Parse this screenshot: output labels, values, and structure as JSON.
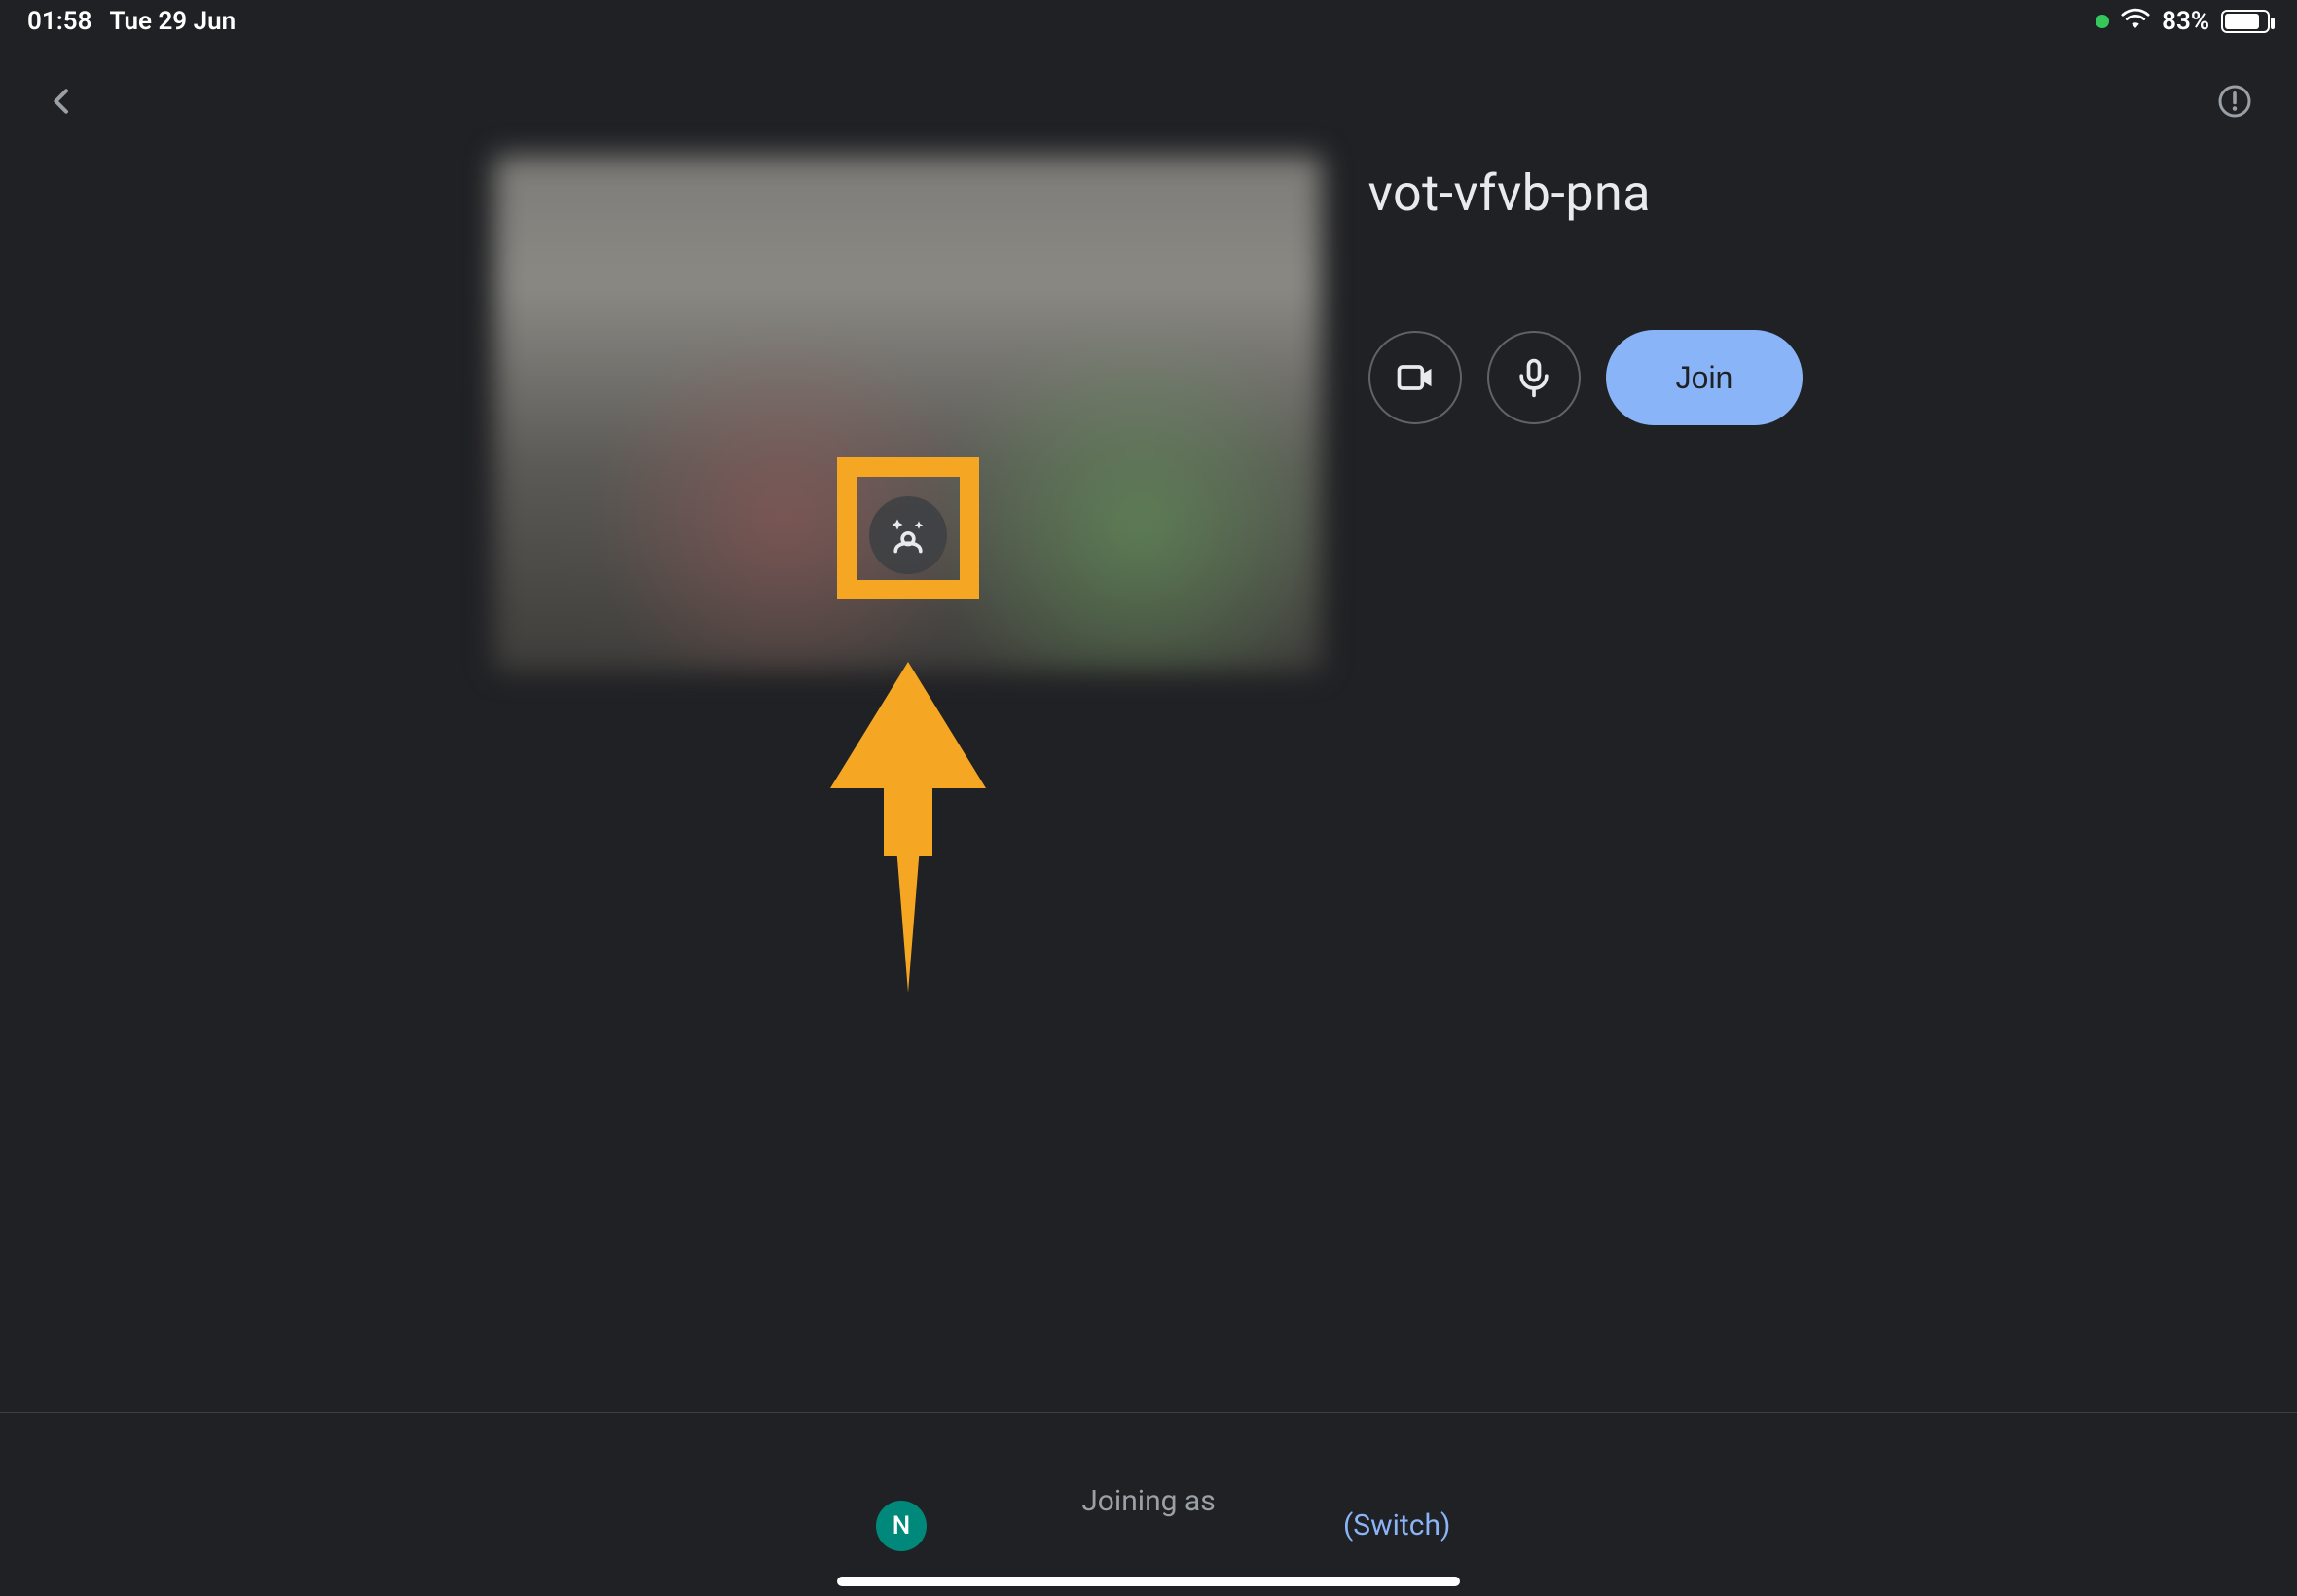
{
  "status_bar": {
    "time": "01:58",
    "date": "Tue 29 Jun",
    "battery_percent": "83%",
    "battery_fill_pct": 83
  },
  "meeting": {
    "code": "vot-vfvb-pna",
    "join_label": "Join"
  },
  "footer": {
    "joining_as_label": "Joining as",
    "avatar_initial": "N",
    "switch_label": "(Switch)"
  },
  "annotations": {
    "highlight_color": "#f5a623"
  }
}
